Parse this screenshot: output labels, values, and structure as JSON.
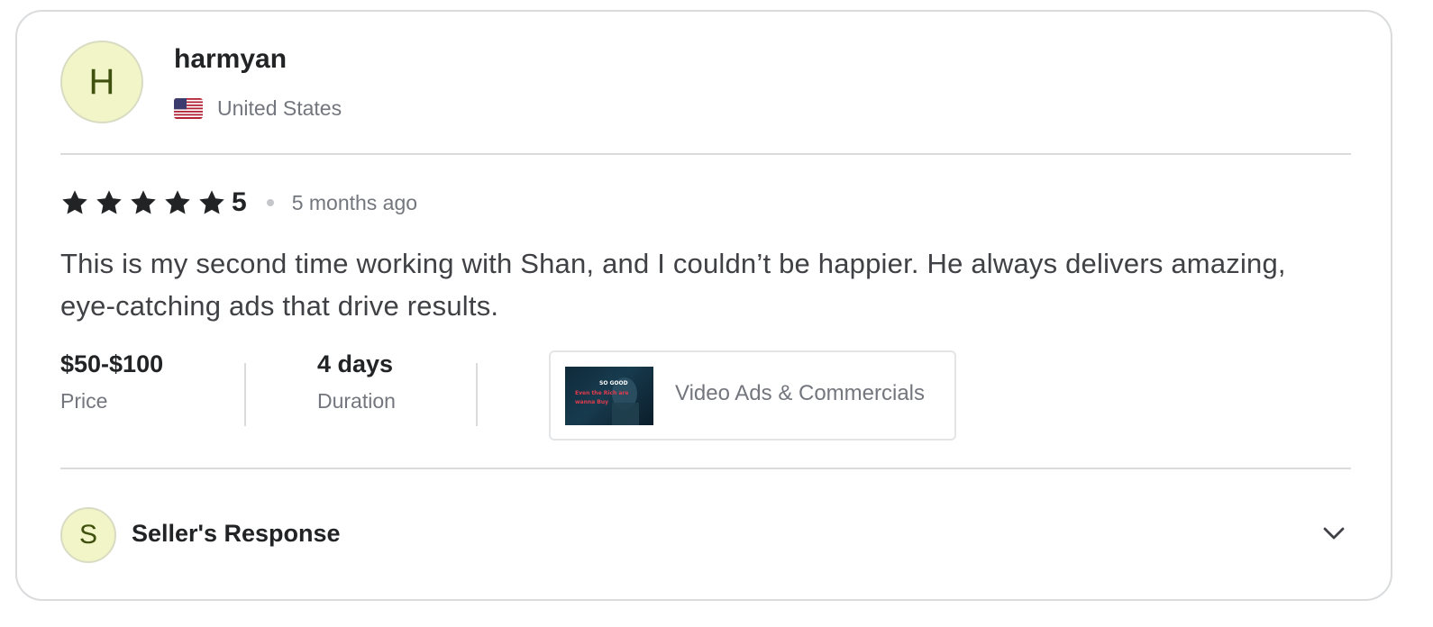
{
  "reviewer": {
    "avatar_initial": "H",
    "username": "harmyan",
    "country": "United States",
    "flag_icon": "us-flag-icon"
  },
  "rating": {
    "stars": 5,
    "value": "5",
    "time_ago": "5 months ago"
  },
  "review": {
    "text": "This is my second time working with Shan, and I couldn’t be happier. He always delivers amazing, eye-catching ads that drive results."
  },
  "meta": {
    "price_value": "$50-$100",
    "price_label": "Price",
    "duration_value": "4 days",
    "duration_label": "Duration"
  },
  "gig": {
    "title": "Video Ads & Commercials",
    "thumb_text": [
      "SO GOOD",
      "Even the Rich are",
      "wanna Buy"
    ]
  },
  "seller_response": {
    "avatar_initial": "S",
    "label": "Seller's Response",
    "expand_icon": "chevron-down-icon"
  },
  "colors": {
    "star": "#222325",
    "avatar_bg": "#f1f5c8",
    "avatar_text": "#40500f",
    "muted_text": "#74767e",
    "border": "#dadbdd"
  }
}
